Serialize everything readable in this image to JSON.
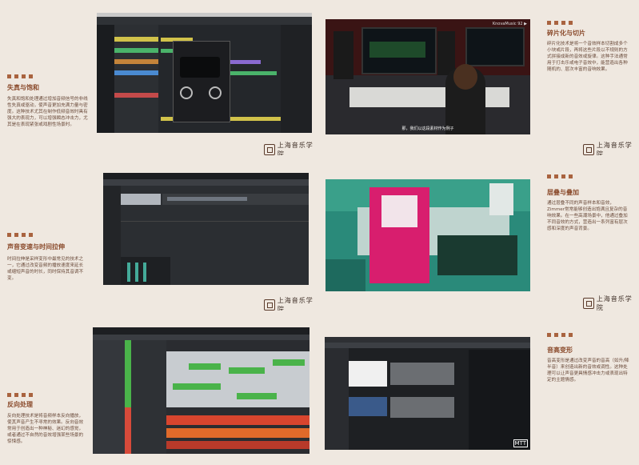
{
  "sections": [
    {
      "title": "失真与饱和",
      "body": "失真和饱和处理通过增加音频信号的非线性失真或驱动，使声音更加充满力量与密度。这种技术尤其在制作低频音效时具有强大的表现力，可以增强瞬态冲击力，尤其是在表现紧张或戏剧性场景时。"
    },
    {
      "title": "碎片化与切片",
      "body": "碎片化技术是将一个音效样本切割成多个小块或片段，再将这些片段以不规则的方式拼接成新的音效或旋律。这种手法通常用于打击乐或电子音效中，能营造出各种随机的、层次丰富的音响效果。"
    },
    {
      "title": "声音变速与时间拉伸",
      "body": "时间拉伸是采样变形中最常见的技术之一，它通过改变音频的播放速度来延长或缩短声音的时长，同时保持其音调不变。"
    },
    {
      "title": "层叠与叠加",
      "body": "通过层叠不同的声音样本和音效，Zimmer常常能够创造出饱满且复杂的音响效果。在一些高潮场景中，他通过叠加不同音效的方式，营造出一系列富有层次感和深度的声音背景。"
    },
    {
      "title": "反向处理",
      "body": "反向处理技术是将音频样本反向播放，使其声音产生不寻常的效果。反向音效常用于创造出一种神秘、迷幻的感觉，或者通过不自然的音效增强某些场景的惊悚感。"
    },
    {
      "title": "音高变形",
      "body": "音高变形是通过改变声音的音高（如升/降半音）来创造出新的音效或调性。这种处理可以让声音更具情感冲击力或表现出特定的主题情感。"
    }
  ],
  "logo_text": "上海音乐学院",
  "video_caption": "那，我们以这段素材作为例子",
  "watermark_knova": "KnovaMusic 92 ▶",
  "watermark_mtt": "MTT",
  "colors": {
    "accent": "#a9633f",
    "heading": "#8a4a2b",
    "background": "#ebe4dc"
  }
}
